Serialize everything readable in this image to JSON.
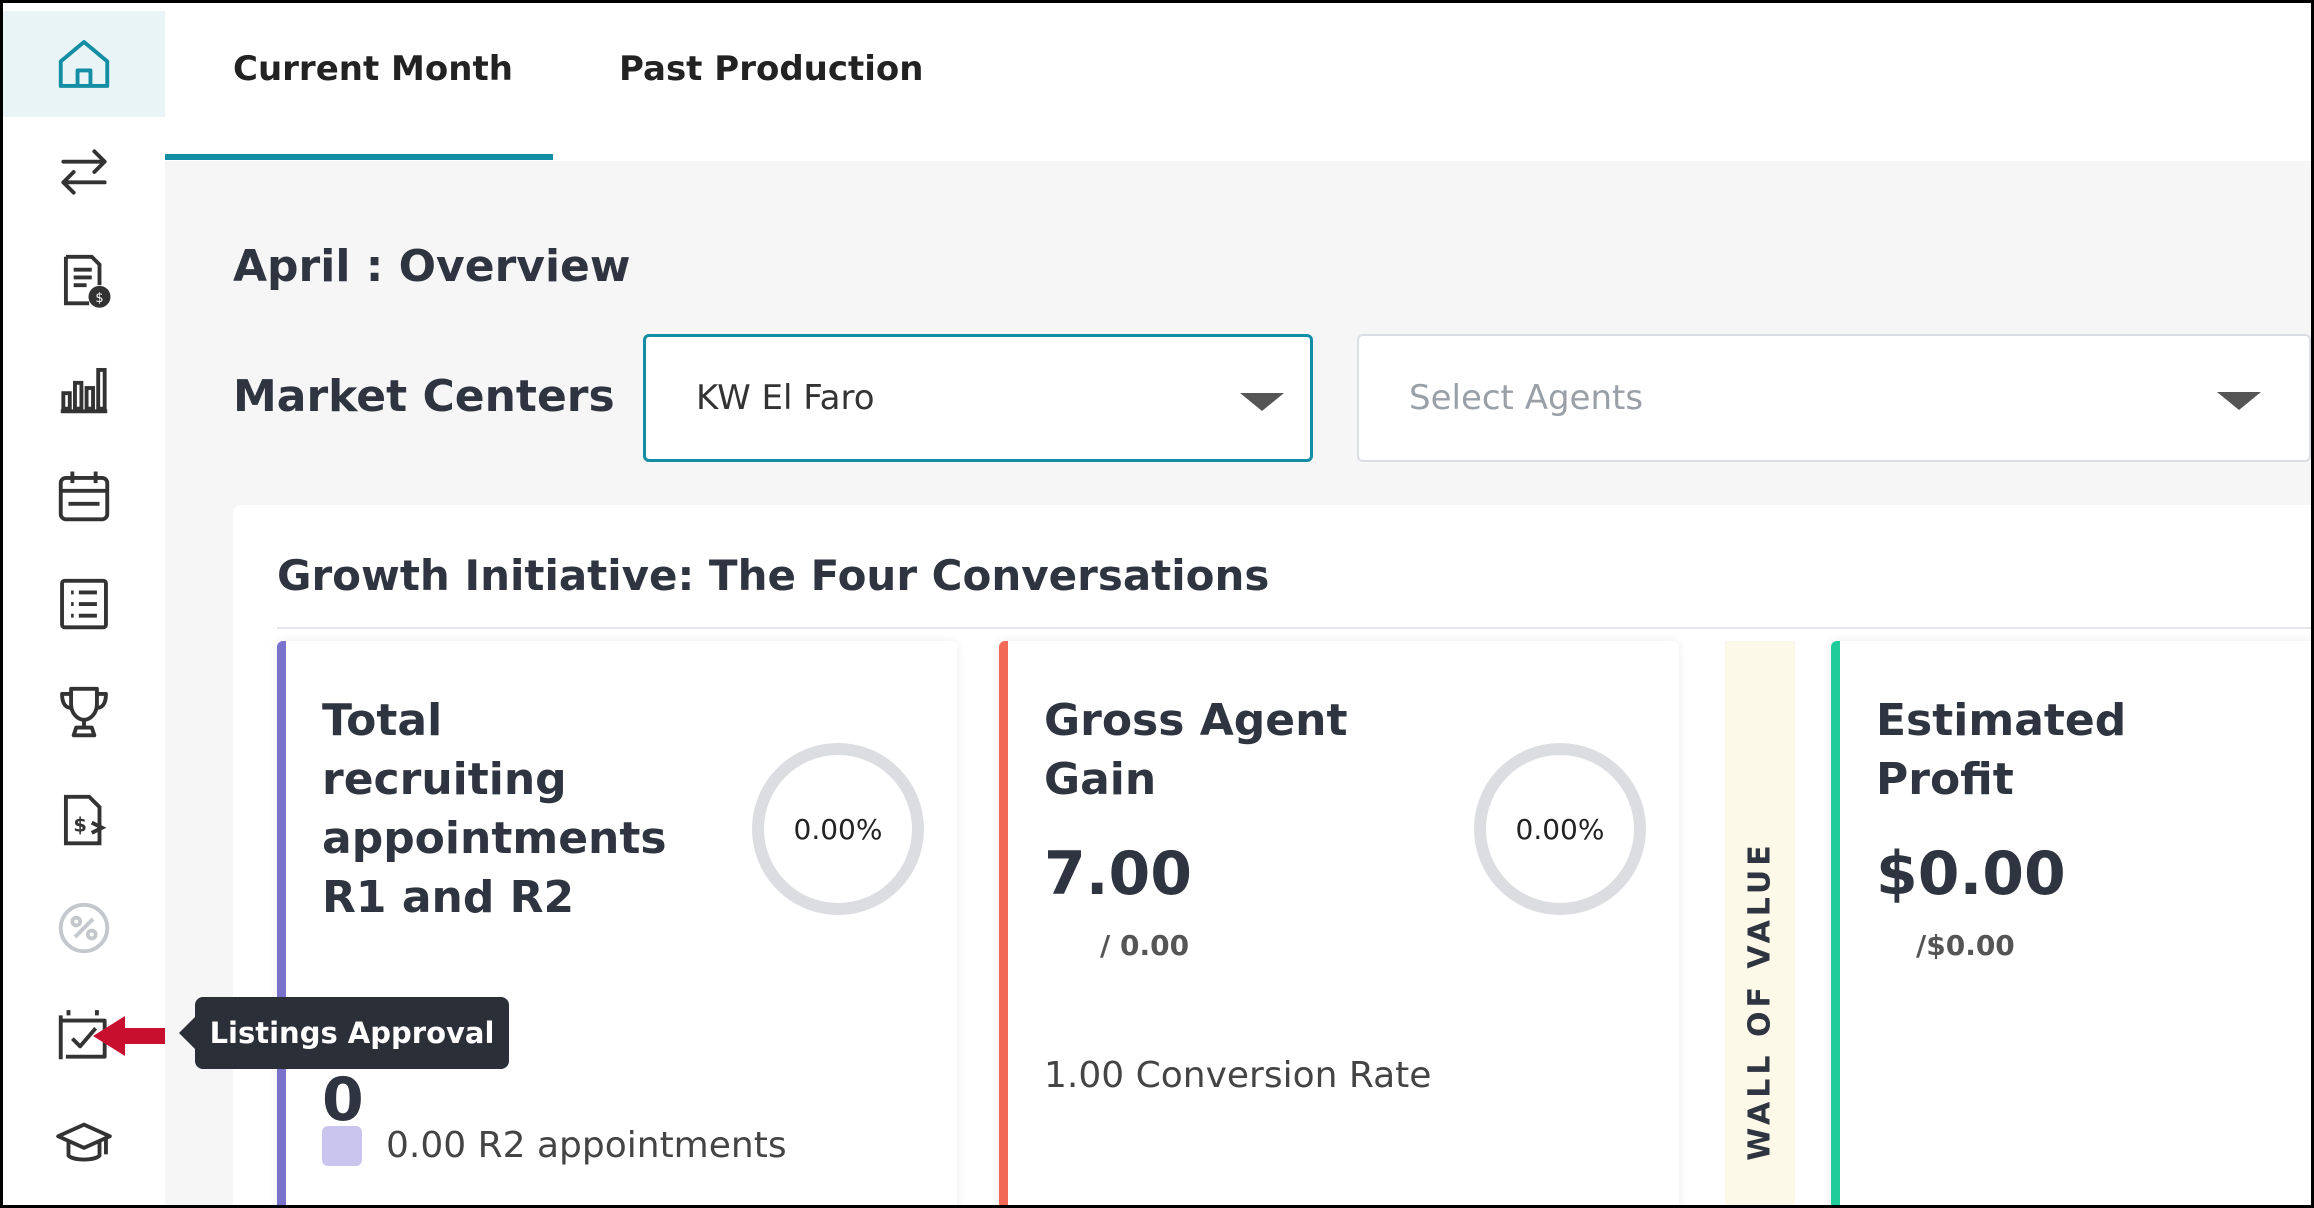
{
  "tabs": [
    {
      "label": "Current Month",
      "active": true
    },
    {
      "label": "Past Production",
      "active": false
    }
  ],
  "page_title": "April : Overview",
  "filters": {
    "market_centers_label": "Market Centers",
    "market_center_value": "KW El Faro",
    "agents_placeholder": "Select Agents"
  },
  "panel": {
    "title": "Growth Initiative: The Four Conversations"
  },
  "cards": [
    {
      "title_lines": [
        "Total",
        "recruiting",
        "appointments",
        "R1 and R2"
      ],
      "percent": "0.00%",
      "value": "0",
      "legend": "0.00 R2 appointments",
      "accent": "#7a71cc"
    },
    {
      "title_lines": [
        "Gross Agent",
        "Gain"
      ],
      "percent": "0.00%",
      "value": "7.00",
      "target": "/ 0.00",
      "rate": "1.00 Conversion Rate",
      "accent": "#f26a57"
    },
    {
      "title_lines": [
        "Estimated",
        "Profit"
      ],
      "value": "$0.00",
      "target": "/$0.00",
      "accent": "#1fcc9a"
    }
  ],
  "wall_label": "WALL OF VALUE",
  "tooltip": "Listings Approval",
  "sidebar_icons": [
    "home-icon",
    "transfer-icon",
    "invoice-icon",
    "bar-chart-icon",
    "calendar-icon",
    "list-icon",
    "trophy-icon",
    "money-document-icon",
    "discount-icon",
    "listings-approval-icon",
    "graduation-cap-icon"
  ],
  "colors": {
    "accent": "#138ea5",
    "tooltip_bg": "#2b2f38",
    "arrow": "#c8102e"
  }
}
